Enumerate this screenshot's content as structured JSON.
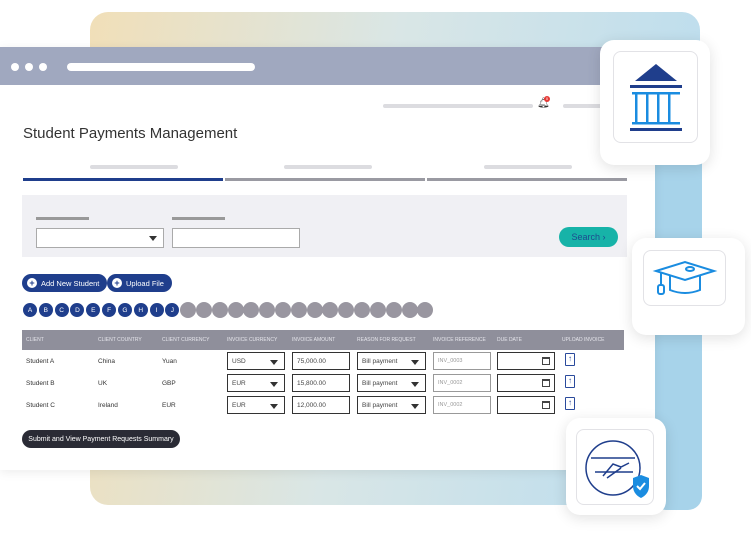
{
  "page_title": "Student Payments Management",
  "notifications": {
    "count": "0",
    "icon": "bell-icon",
    "badge_color": "#e53935"
  },
  "filter": {
    "search_label": "Search ›"
  },
  "actions": {
    "add_student": "Add New Student",
    "upload_file": "Upload File"
  },
  "letters": [
    "A",
    "B",
    "C",
    "D",
    "E",
    "F",
    "G",
    "H",
    "I",
    "J",
    "",
    "",
    "",
    "",
    "",
    "",
    "",
    "",
    "",
    "",
    "",
    "",
    "",
    "",
    "",
    ""
  ],
  "table": {
    "headers": [
      "Client",
      "Client Country",
      "Client Currency",
      "Invoice Currency",
      "Invoice Amount",
      "Reason for Request",
      "Invoice Reference",
      "Due Date",
      "Upload Invoice"
    ],
    "rows": [
      {
        "client": "Student A",
        "country": "China",
        "currency": "Yuan",
        "invoice_currency": "USD",
        "amount": "75,000.00",
        "reason": "Bill payment",
        "reference": "INV_0003"
      },
      {
        "client": "Student B",
        "country": "UK",
        "currency": "GBP",
        "invoice_currency": "EUR",
        "amount": "15,800.00",
        "reason": "Bill payment",
        "reference": "INV_0002"
      },
      {
        "client": "Student C",
        "country": "Ireland",
        "currency": "EUR",
        "invoice_currency": "EUR",
        "amount": "12,000.00",
        "reason": "Bill payment",
        "reference": "INV_0002"
      }
    ]
  },
  "submit_label": "Submit and View Payment Requests Summary",
  "colors": {
    "primary": "#1f3e8c",
    "accent": "#17b3a8",
    "header": "#a0a8bf"
  }
}
